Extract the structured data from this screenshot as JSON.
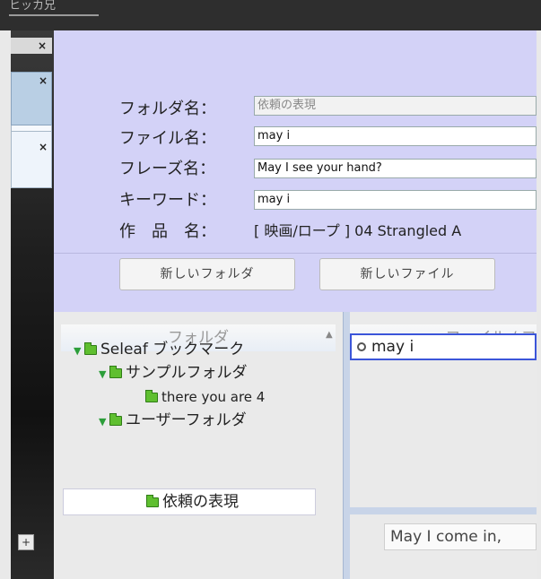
{
  "window": {
    "title_fragment": "ヒッカ兄"
  },
  "side_tabs": {
    "close_glyph": "×",
    "add_glyph": "+"
  },
  "info": {
    "folder_label": "フォルダ名：",
    "folder_value": "依頼の表現",
    "file_label": "ファイル名：",
    "file_value": "may i",
    "phrase_label": "フレーズ名：",
    "phrase_value": "May I see your hand?",
    "keyword_label": "キーワード：",
    "keyword_value": "may i",
    "work_label": "作　品　名：",
    "work_value": "[ 映画/ロープ ] 04 Strangled A",
    "new_folder_button": "新しいフォルダ",
    "new_file_button": "新しいファイル"
  },
  "folders": {
    "header": "フォルダ",
    "items": [
      {
        "label": "Seleaf ブックマーク"
      },
      {
        "label": "サンプルフォルダ"
      },
      {
        "label": "there you are  4"
      },
      {
        "label": "ユーザーフォルダ"
      },
      {
        "label": "依頼の表現"
      }
    ]
  },
  "files": {
    "header": "ファイル / フ",
    "items": [
      {
        "label": "may i"
      }
    ],
    "phrase_preview": "May I come in,"
  },
  "colors": {
    "info_bg": "#d3d2f7",
    "selection_border": "#3b55d9",
    "folder_green": "#5fbf30"
  }
}
